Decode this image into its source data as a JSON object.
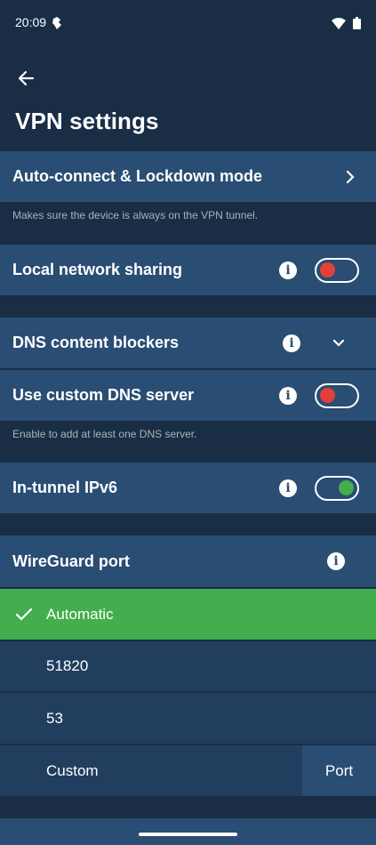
{
  "status_bar": {
    "time": "20:09"
  },
  "header": {
    "title": "VPN settings"
  },
  "auto_connect": {
    "label": "Auto-connect & Lockdown mode",
    "description": "Makes sure the device is always on the VPN tunnel."
  },
  "local_network_sharing": {
    "label": "Local network sharing",
    "enabled": false
  },
  "dns_content_blockers": {
    "label": "DNS content blockers",
    "expanded": false
  },
  "custom_dns": {
    "label": "Use custom DNS server",
    "enabled": false,
    "description": "Enable to add at least one DNS server."
  },
  "ipv6": {
    "label": "In-tunnel IPv6",
    "enabled": true
  },
  "wireguard_port": {
    "label": "WireGuard port",
    "options": [
      {
        "label": "Automatic",
        "selected": true
      },
      {
        "label": "51820",
        "selected": false
      },
      {
        "label": "53",
        "selected": false
      },
      {
        "label": "Custom",
        "selected": false
      }
    ],
    "custom_placeholder": "Port"
  },
  "colors": {
    "background": "#192e45",
    "row": "#294d73",
    "sub_row": "#213e5e",
    "selected": "#44ad4d",
    "toggle_off": "#e34039",
    "toggle_on": "#44ad4d"
  }
}
